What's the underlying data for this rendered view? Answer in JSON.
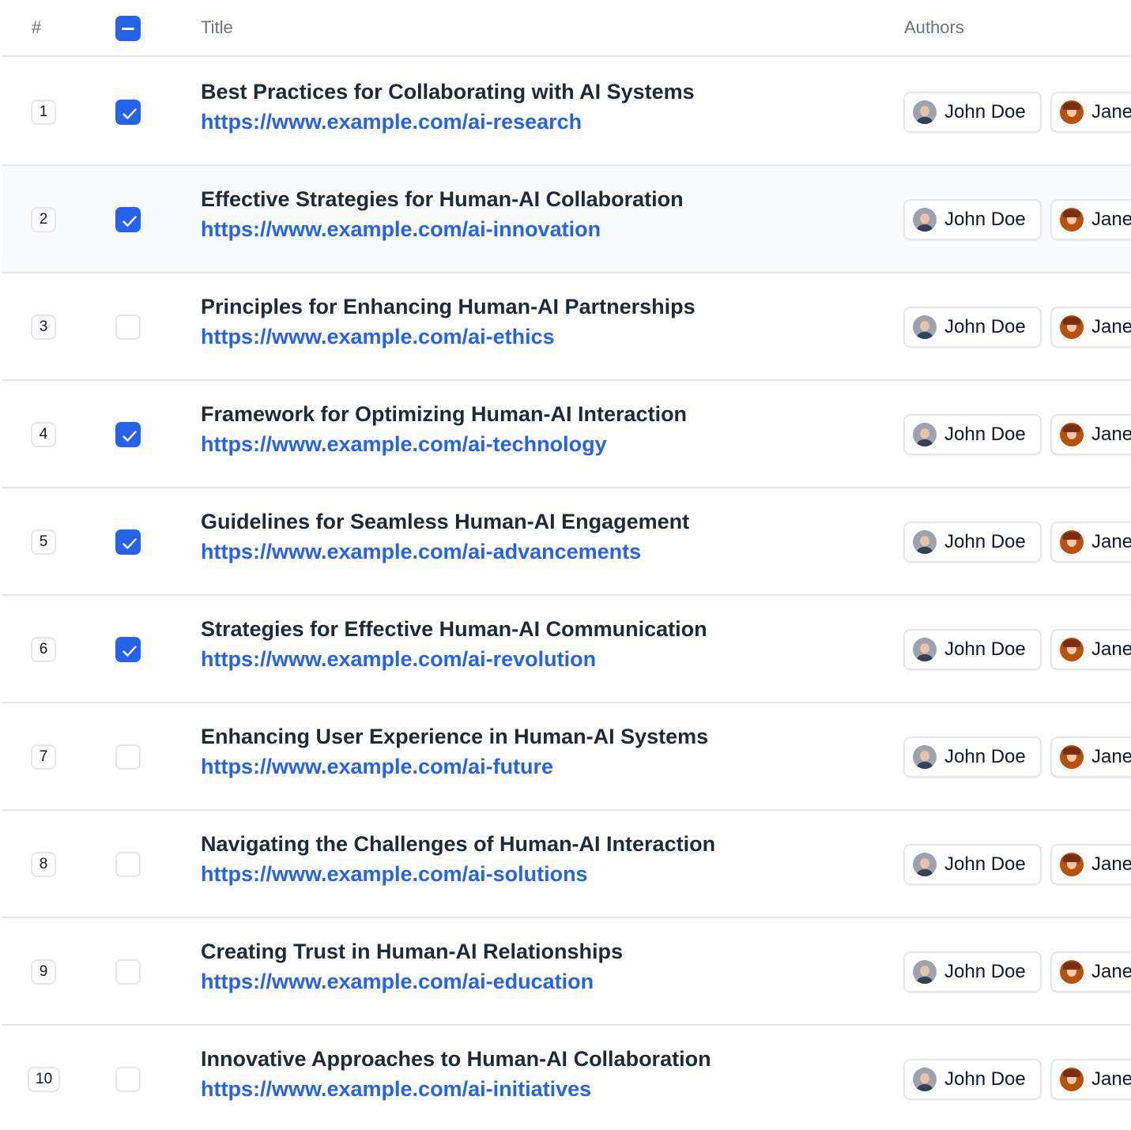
{
  "header": {
    "num_label": "#",
    "title_label": "Title",
    "authors_label": "Authors"
  },
  "rows": [
    {
      "num": "1",
      "title": "Best Practices for Collaborating with AI Systems",
      "url": "https://www.example.com/ai-research",
      "checked": true,
      "authors": [
        "John Doe",
        "Jane"
      ]
    },
    {
      "num": "2",
      "title": "Effective Strategies for Human-AI Collaboration",
      "url": "https://www.example.com/ai-innovation",
      "checked": true,
      "authors": [
        "John Doe",
        "Jane"
      ]
    },
    {
      "num": "3",
      "title": "Principles for Enhancing Human-AI Partnerships",
      "url": "https://www.example.com/ai-ethics",
      "checked": false,
      "authors": [
        "John Doe",
        "Jane"
      ]
    },
    {
      "num": "4",
      "title": "Framework for Optimizing Human-AI Interaction",
      "url": "https://www.example.com/ai-technology",
      "checked": true,
      "authors": [
        "John Doe",
        "Jane"
      ]
    },
    {
      "num": "5",
      "title": "Guidelines for Seamless Human-AI Engagement",
      "url": "https://www.example.com/ai-advancements",
      "checked": true,
      "authors": [
        "John Doe",
        "Jane"
      ]
    },
    {
      "num": "6",
      "title": "Strategies for Effective Human-AI Communication",
      "url": "https://www.example.com/ai-revolution",
      "checked": true,
      "authors": [
        "John Doe",
        "Jane"
      ]
    },
    {
      "num": "7",
      "title": "Enhancing User Experience in Human-AI Systems",
      "url": "https://www.example.com/ai-future",
      "checked": false,
      "authors": [
        "John Doe",
        "Jane"
      ]
    },
    {
      "num": "8",
      "title": "Navigating the Challenges of Human-AI Interaction",
      "url": "https://www.example.com/ai-solutions",
      "checked": false,
      "authors": [
        "John Doe",
        "Jane"
      ]
    },
    {
      "num": "9",
      "title": "Creating Trust in Human-AI Relationships",
      "url": "https://www.example.com/ai-education",
      "checked": false,
      "authors": [
        "John Doe",
        "Jane"
      ]
    },
    {
      "num": "10",
      "title": "Innovative Approaches to Human-AI Collaboration",
      "url": "https://www.example.com/ai-initiatives",
      "checked": false,
      "authors": [
        "John Doe",
        "Jane"
      ]
    }
  ],
  "highlighted_row": "2",
  "colors": {
    "accent": "#2563eb",
    "border": "#e5e7eb",
    "header_text": "#6b7280",
    "row_highlight": "#f8fafc"
  }
}
